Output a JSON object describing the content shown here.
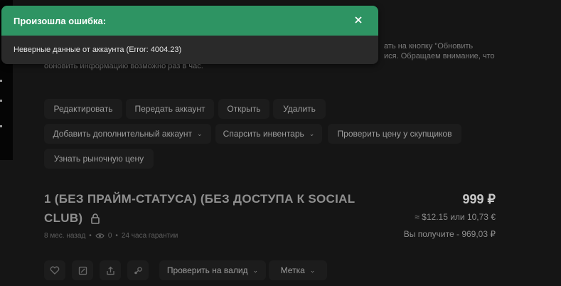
{
  "background": {
    "notice_line1": "ать на кнопку \"Обновить",
    "notice_line2": "ися. Обращаем внимание, что",
    "notice_line3": "обновить информацию возможно раз в час."
  },
  "actions": {
    "row1": [
      "Редактировать",
      "Передать аккаунт",
      "Открыть",
      "Удалить"
    ],
    "row2": [
      "Добавить дополнительный аккаунт",
      "Спарсить инвентарь",
      "Проверить цену у скупщиков"
    ],
    "row3": [
      "Узнать рыночную цену"
    ]
  },
  "listing": {
    "title_line1": "1 (БЕЗ ПРАЙМ-СТАТУСА) (БЕЗ ДОСТУПА К SOCIAL",
    "title_line2": "CLUB)",
    "price": "999 ₽",
    "price_converted": "≈ $12.15 или 10,73 €",
    "you_receive": "Вы получите - 969,03 ₽",
    "age": "8 мес. назад",
    "views": "0",
    "guarantee": "24 часа гарантии"
  },
  "bottom_bar": {
    "check_valid": "Проверить на валид",
    "tag": "Метка"
  },
  "toast": {
    "title": "Произошла ошибка:",
    "message": "Неверные данные от аккаунта (Error: 4004.23)",
    "header_color": "#2e9463"
  }
}
